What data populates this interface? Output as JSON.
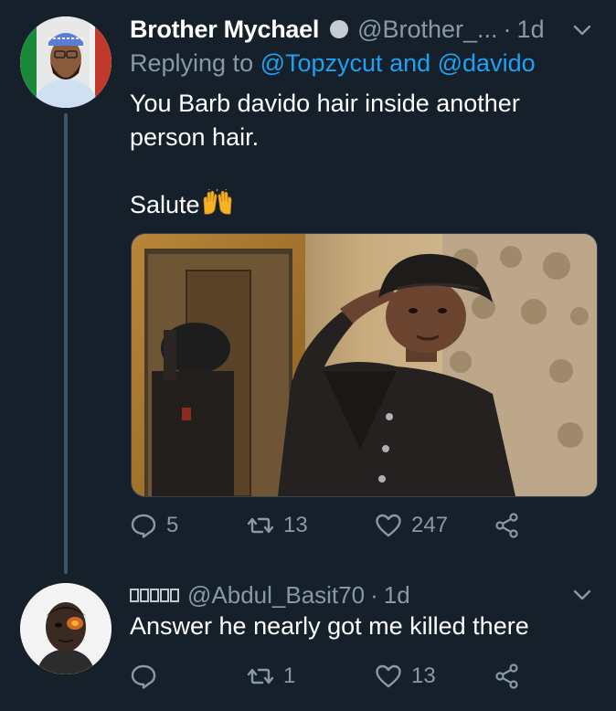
{
  "tweet1": {
    "display_name": "Brother Mychael",
    "handle": "@Brother_...",
    "separator": "·",
    "time": "1d",
    "replying_prefix": "Replying to ",
    "mention1": "@Topzycut",
    "mention_joiner": " and ",
    "mention2": "@davido",
    "text_line1": "You Barb davido hair inside another",
    "text_line2": "person hair.",
    "text_line3": "Salute",
    "media_icon": "salute-photo",
    "replies": "5",
    "retweets": "13",
    "likes": "247"
  },
  "tweet2": {
    "display_name_glyphs": [
      "▯",
      "▯",
      "▯",
      "▯",
      "▯"
    ],
    "handle": "@Abdul_Basit70",
    "separator": "·",
    "time": "1d",
    "text": "Answer he nearly got me killed there",
    "replies": "",
    "retweets": "1",
    "likes": "13"
  },
  "icons": {
    "reply": "reply-icon",
    "retweet": "retweet-icon",
    "like": "heart-icon",
    "share": "share-icon",
    "caret": "chevron-down-icon",
    "emoji": "raising-hands-emoji"
  },
  "colors": {
    "background": "#15202b",
    "text": "#ffffff",
    "muted": "#8899a6",
    "link": "#1da1f2",
    "thread_line": "#3d5466"
  }
}
